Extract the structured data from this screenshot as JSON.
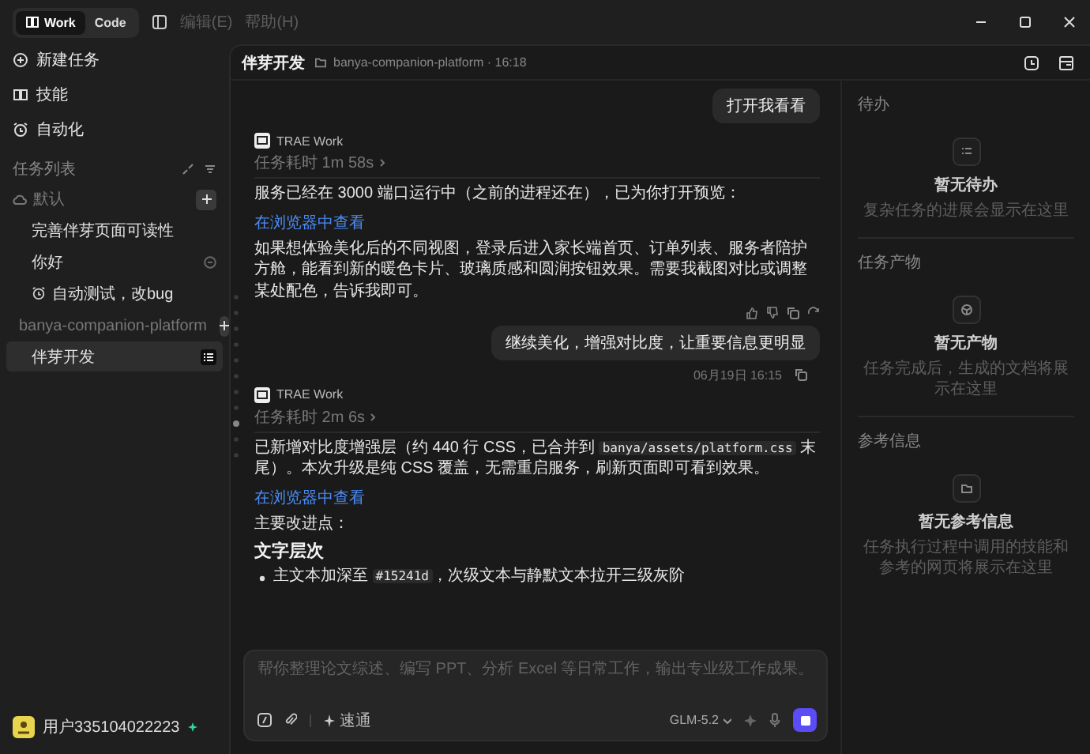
{
  "titlebar": {
    "modes": [
      {
        "label": "Work",
        "selected": true
      },
      {
        "label": "Code",
        "selected": false
      }
    ],
    "menu": [
      {
        "label": "编辑(E)",
        "disabled": true
      },
      {
        "label": "帮助(H)",
        "disabled": true
      }
    ]
  },
  "sidebar": {
    "actions": [
      {
        "label": "新建任务"
      },
      {
        "label": "技能"
      },
      {
        "label": "自动化"
      }
    ],
    "task_list_title": "任务列表",
    "groups": [
      {
        "name": "默认",
        "kind": "cloud",
        "tasks": [
          {
            "title": "完善伴芽页面可读性",
            "selected": false,
            "scheduled": false,
            "pending": false
          },
          {
            "title": "你好",
            "selected": false,
            "scheduled": false,
            "pending": true
          },
          {
            "title": "自动测试，改bug",
            "selected": false,
            "scheduled": true,
            "pending": false
          }
        ]
      },
      {
        "name": "banya-companion-platform",
        "kind": "folder",
        "tasks": [
          {
            "title": "伴芽开发",
            "selected": true,
            "scheduled": false,
            "pending": false
          }
        ]
      }
    ],
    "user": {
      "name": "用户335104022223",
      "online": true
    }
  },
  "header": {
    "title": "伴芽开发",
    "meta": "banya-companion-platform · 16:18"
  },
  "messages": [
    {
      "kind": "user",
      "text": "打开我看看"
    },
    {
      "kind": "assistant",
      "author": "TRAE Work",
      "duration": "任务耗时 1m 58s",
      "show_actions": true,
      "blocks": [
        {
          "kind": "p",
          "parts": [
            {
              "text": "服务已经在 3000 端口运行中（之前的进程还在），已为你打开预览：",
              "code": false
            }
          ]
        },
        {
          "kind": "link",
          "text": "在浏览器中查看"
        },
        {
          "kind": "p",
          "parts": [
            {
              "text": "如果想体验美化后的不同视图，登录后进入家长端首页、订单列表、服务者陪护方舱，能看到新的暖色卡片、玻璃质感和圆润按钮效果。需要我截图对比或调整某处配色，告诉我即可。",
              "code": false
            }
          ]
        }
      ]
    },
    {
      "kind": "user",
      "text": "继续美化，增强对比度，让重要信息更明显",
      "timestamp": "06月19日 16:15"
    },
    {
      "kind": "assistant",
      "author": "TRAE Work",
      "duration": "任务耗时 2m 6s",
      "show_actions": false,
      "blocks": [
        {
          "kind": "p",
          "parts": [
            {
              "text": "已新增对比度增强层（约 440 行 CSS，已合并到 ",
              "code": false
            },
            {
              "text": "banya/assets/platform.css",
              "code": true
            },
            {
              "text": " 末尾）。本次升级是纯 CSS 覆盖，无需重启服务，刷新页面即可看到效果。",
              "code": false
            }
          ]
        },
        {
          "kind": "link",
          "text": "在浏览器中查看"
        },
        {
          "kind": "p",
          "parts": [
            {
              "text": "主要改进点：",
              "code": false
            }
          ]
        },
        {
          "kind": "heading",
          "text": "文字层次"
        },
        {
          "kind": "bullet",
          "parts": [
            {
              "text": "主文本加深至 ",
              "code": false
            },
            {
              "text": "#15241d",
              "code": true
            },
            {
              "text": "，次级文本与静默文本拉开三级灰阶",
              "code": false
            }
          ]
        }
      ]
    }
  ],
  "composer": {
    "placeholder": "帮你整理论文综述、编写 PPT、分析 Excel 等日常工作，输出专业级工作成果。",
    "mode": "速通",
    "model": "GLM-5.2",
    "running": true
  },
  "panel": {
    "sections": [
      {
        "title": "待办",
        "empty_title": "暂无待办",
        "empty_text": "复杂任务的进展会显示在这里"
      },
      {
        "title": "任务产物",
        "empty_title": "暂无产物",
        "empty_text": "任务完成后，生成的文档将展示在这里"
      },
      {
        "title": "参考信息",
        "empty_title": "暂无参考信息",
        "empty_text": "任务执行过程中调用的技能和参考的网页将展示在这里"
      }
    ]
  }
}
